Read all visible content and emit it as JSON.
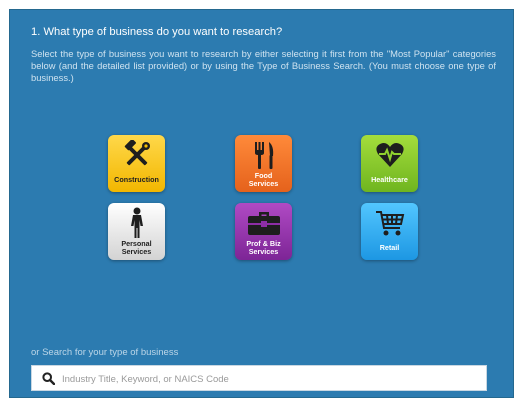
{
  "question": {
    "heading": "1. What type of business do you want to research?",
    "description": "Select the type of business you want to research by either selecting it first from the \"Most Popular\" categories below (and the detailed list provided) or by using the Type of Business Search. (You must choose one type of business.)"
  },
  "categories": [
    {
      "label_line1": "Construction",
      "label_line2": "",
      "icon": "construction-tools-icon",
      "color": "#f5c000"
    },
    {
      "label_line1": "Food",
      "label_line2": "Services",
      "icon": "fork-knife-icon",
      "color": "#e8681f"
    },
    {
      "label_line1": "Healthcare",
      "label_line2": "",
      "icon": "heartbeat-icon",
      "color": "#7cc024"
    },
    {
      "label_line1": "Personal",
      "label_line2": "Services",
      "icon": "person-icon",
      "color": "#e0e0e0"
    },
    {
      "label_line1": "Prof & Biz",
      "label_line2": "Services",
      "icon": "briefcase-icon",
      "color": "#8e2ea6"
    },
    {
      "label_line1": "Retail",
      "label_line2": "",
      "icon": "shopping-cart-icon",
      "color": "#2aa4ef"
    }
  ],
  "search": {
    "label": "or Search for your type of business",
    "placeholder": "Industry Title, Keyword, or NAICS Code",
    "value": ""
  },
  "colors": {
    "panel_background": "#2c7bb0"
  }
}
